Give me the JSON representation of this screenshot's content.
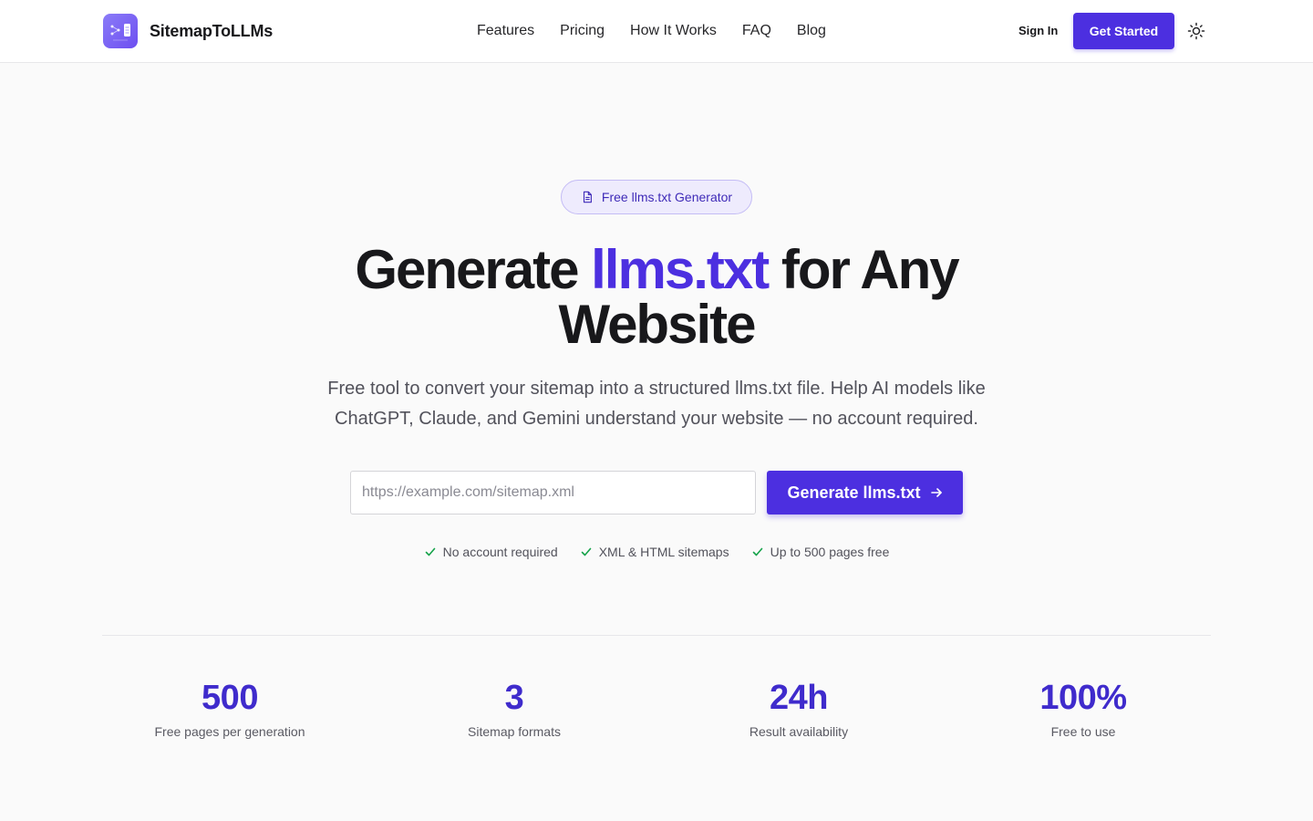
{
  "header": {
    "brand": "SitemapToLLMs",
    "nav": [
      "Features",
      "Pricing",
      "How It Works",
      "FAQ",
      "Blog"
    ],
    "sign_in": "Sign In",
    "get_started": "Get Started"
  },
  "hero": {
    "badge": "Free llms.txt Generator",
    "title_part1": "Generate ",
    "title_accent": "llms.txt",
    "title_part2": " for Any Website",
    "subtitle": "Free tool to convert your sitemap into a structured llms.txt file. Help AI models like ChatGPT, Claude, and Gemini understand your website — no account required.",
    "input_placeholder": "https://example.com/sitemap.xml",
    "input_value": "",
    "generate_button": "Generate llms.txt",
    "features": [
      "No account required",
      "XML & HTML sitemaps",
      "Up to 500 pages free"
    ]
  },
  "stats": [
    {
      "value": "500",
      "label": "Free pages per generation"
    },
    {
      "value": "3",
      "label": "Sitemap formats"
    },
    {
      "value": "24h",
      "label": "Result availability"
    },
    {
      "value": "100%",
      "label": "Free to use"
    }
  ],
  "icons": {
    "logo": "sitemap-logo-icon",
    "theme": "sun-icon",
    "badge": "file-text-icon",
    "button": "arrow-right-icon",
    "feature": "check-icon"
  },
  "colors": {
    "accent": "#4c2fe0",
    "check": "#16a34a",
    "background": "#fafafa"
  }
}
